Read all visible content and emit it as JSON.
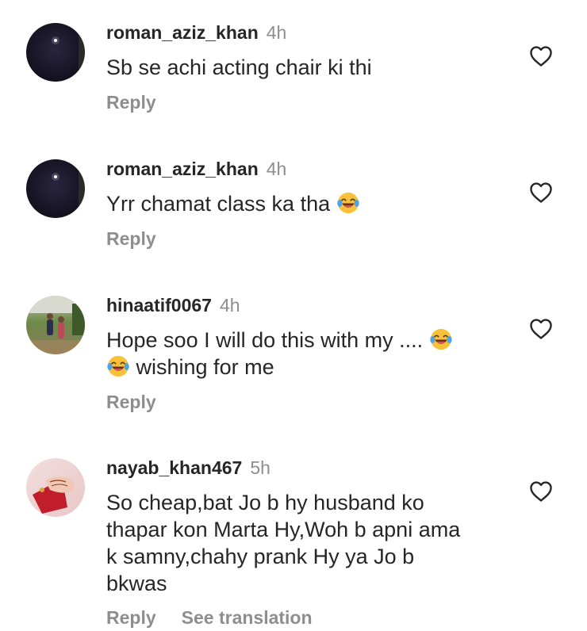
{
  "comments": [
    {
      "username": "roman_aziz_khan",
      "time": "4h",
      "text_lines": [
        "Sb se achi acting chair ki thi"
      ],
      "actions": [
        "Reply"
      ],
      "avatar": "night-sky-avatar"
    },
    {
      "username": "roman_aziz_khan",
      "time": "4h",
      "text_lines": [
        "Yrr chamat class ka tha"
      ],
      "text_emojis": [
        "laughing-tears-emoji"
      ],
      "actions": [
        "Reply"
      ],
      "avatar": "night-sky-avatar"
    },
    {
      "username": "hinaatif0067",
      "time": "4h",
      "text_lines": [
        "Hope soo I will do this with my ....",
        "wishing for me"
      ],
      "text_emojis": [
        "laughing-tears-emoji",
        "laughing-tears-emoji"
      ],
      "actions": [
        "Reply"
      ],
      "avatar": "children-outdoor-avatar"
    },
    {
      "username": "nayab_khan467",
      "time": "5h",
      "text_lines": [
        "So cheap,bat Jo b hy husband ko",
        "thapar kon Marta Hy,Woh b apni ama",
        "k samny,chahy prank Hy ya Jo b",
        "bkwas"
      ],
      "actions": [
        "Reply",
        "See translation"
      ],
      "avatar": "henna-hand-avatar"
    }
  ],
  "icons": {
    "like": "heart-outline-icon"
  },
  "colors": {
    "text": "#262626",
    "secondary": "#8e8e8e",
    "background": "#ffffff"
  }
}
